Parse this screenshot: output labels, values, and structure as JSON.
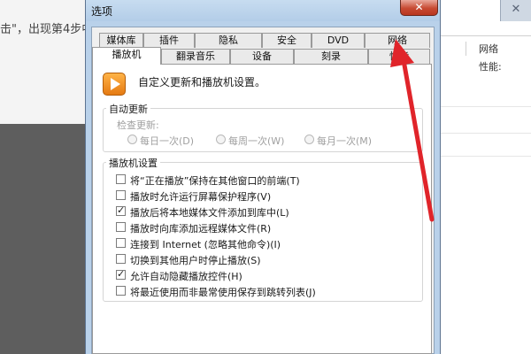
{
  "background": {
    "left_text": "击\"，出现第4步中",
    "right_headers": [
      "网络",
      "性能:"
    ]
  },
  "dialog": {
    "title": "选项",
    "close_glyph": "✕"
  },
  "tabs_row1": [
    "媒体库",
    "插件",
    "隐私",
    "安全",
    "DVD",
    "网络"
  ],
  "tabs_row2": [
    "播放机",
    "翻录音乐",
    "设备",
    "刻录",
    "性能"
  ],
  "active_tab": "播放机",
  "intro_text": "自定义更新和播放机设置。",
  "auto_update": {
    "legend": "自动更新",
    "check_label": "检查更新:",
    "options": [
      "每日一次(D)",
      "每周一次(W)",
      "每月一次(M)"
    ]
  },
  "player_settings": {
    "legend": "播放机设置",
    "items": [
      {
        "label": "将“正在播放”保持在其他窗口的前端(T)",
        "checked": false
      },
      {
        "label": "播放时允许运行屏幕保护程序(V)",
        "checked": false
      },
      {
        "label": "播放后将本地媒体文件添加到库中(L)",
        "checked": true
      },
      {
        "label": "播放时向库添加远程媒体文件(R)",
        "checked": false
      },
      {
        "label": "连接到 Internet (忽略其他命令)(I)",
        "checked": false
      },
      {
        "label": "切换到其他用户时停止播放(S)",
        "checked": false
      },
      {
        "label": "允许自动隐藏播放控件(H)",
        "checked": true
      },
      {
        "label": "将最近使用而非最常使用保存到跳转列表(J)",
        "checked": false
      }
    ]
  },
  "colors": {
    "annotation_arrow": "#e0242a",
    "dialog_frame": "#b9d1ea",
    "close_button": "#c74a32"
  }
}
